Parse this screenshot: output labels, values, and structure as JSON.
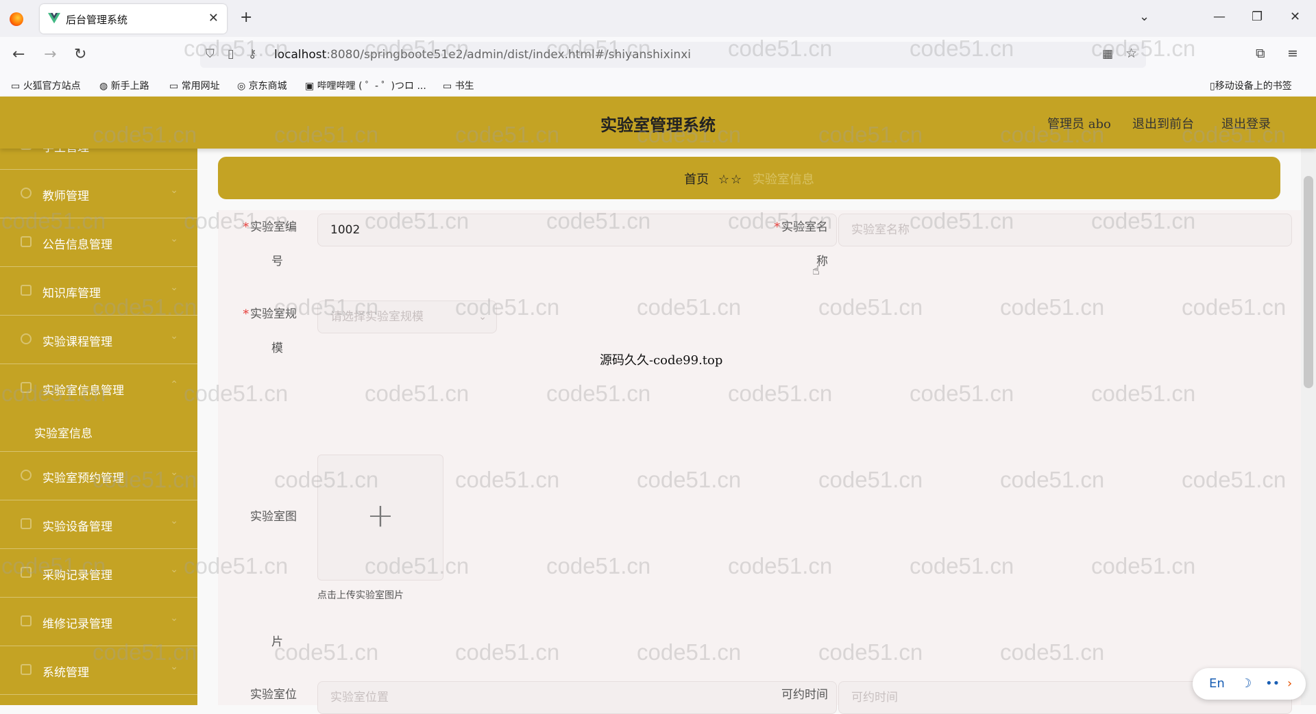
{
  "browser": {
    "tab_title": "后台管理系统",
    "url_host": "localhost",
    "url_rest": ":8080/springboote51e2/admin/dist/index.html#/shiyanshixinxi",
    "bookmarks": [
      "火狐官方站点",
      "新手上路",
      "常用网址",
      "京东商城",
      "哔哩哔哩 ( ゜- ゜)つロ ...",
      "书生"
    ],
    "mobile_bookmarks": "移动设备上的书签"
  },
  "header": {
    "title": "实验室管理系统",
    "user": "管理员 abo",
    "to_front": "退出到前台",
    "logout": "退出登录"
  },
  "sidebar": {
    "items": [
      {
        "label": "学生管理"
      },
      {
        "label": "教师管理"
      },
      {
        "label": "公告信息管理"
      },
      {
        "label": "知识库管理"
      },
      {
        "label": "实验课程管理"
      },
      {
        "label": "实验室信息管理"
      },
      {
        "label": "实验室预约管理"
      },
      {
        "label": "实验设备管理"
      },
      {
        "label": "采购记录管理"
      },
      {
        "label": "维修记录管理"
      },
      {
        "label": "系统管理"
      }
    ],
    "sub_item": "实验室信息"
  },
  "breadcrumb": {
    "home": "首页",
    "stars": "☆☆",
    "current": "实验室信息"
  },
  "form": {
    "lab_no_label_1": "实验室编",
    "lab_no_label_2": "号",
    "lab_no_value": "1002",
    "lab_name_label_1": "实验室名",
    "lab_name_label_2": "称",
    "lab_name_placeholder": "实验室名称",
    "lab_scale_label_1": "实验室规",
    "lab_scale_label_2": "模",
    "lab_scale_placeholder": "请选择实验室规模",
    "lab_image_label_1": "实验室图",
    "lab_image_label_2": "片",
    "upload_tip": "点击上传实验室图片",
    "lab_location_label": "实验室位",
    "lab_location_placeholder": "实验室位置",
    "available_time_label": "可约时间",
    "available_time_placeholder": "可约时间"
  },
  "overlay_text": "源码久久-code99.top",
  "watermark": "code51.cn",
  "ime": {
    "lang": "En"
  },
  "colors": {
    "brand": "#c4a324",
    "form_bg": "#f7f2f2",
    "required": "#e53935"
  }
}
